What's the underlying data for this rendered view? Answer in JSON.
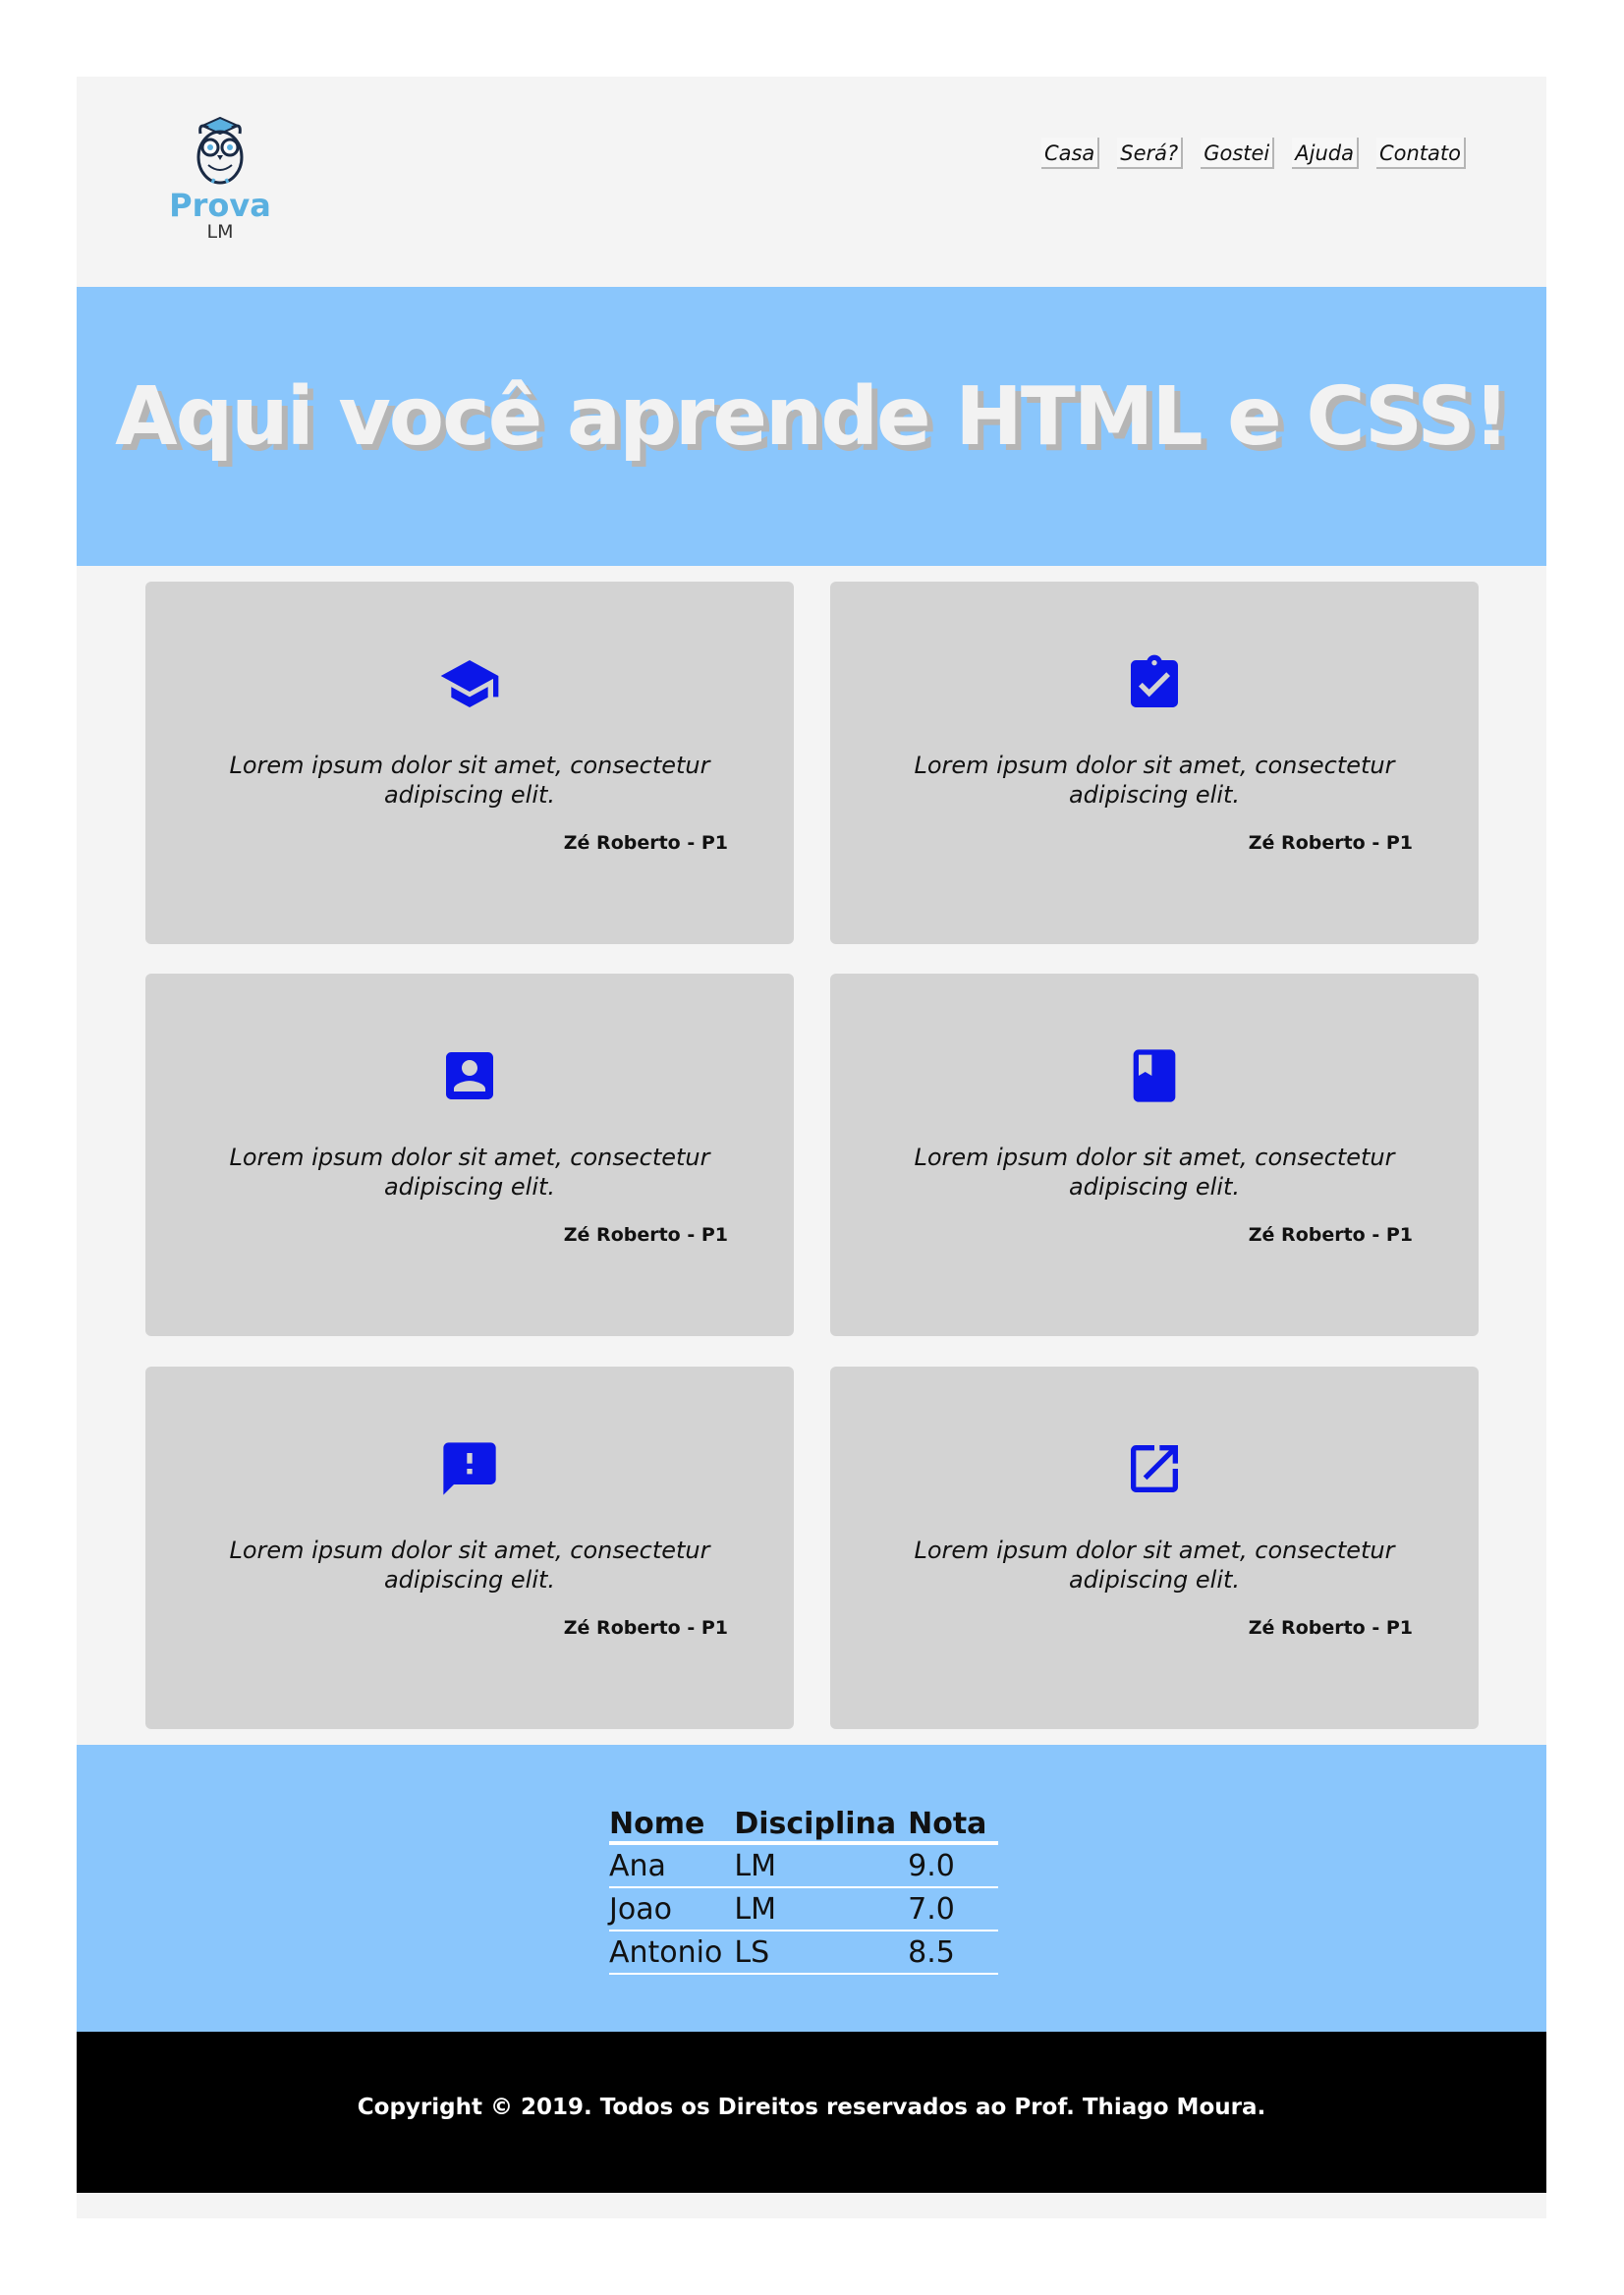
{
  "logo": {
    "title": "Prova",
    "subtitle": "LM"
  },
  "nav": {
    "items": [
      "Casa",
      "Será?",
      "Gostei",
      "Ajuda",
      "Contato"
    ]
  },
  "hero": {
    "title": "Aqui você aprende HTML e CSS!"
  },
  "cards": [
    {
      "icon": "graduation-cap-icon",
      "text": "Lorem ipsum dolor sit amet, consectetur adipiscing elit.",
      "author": "Zé Roberto - P1"
    },
    {
      "icon": "clipboard-check-icon",
      "text": "Lorem ipsum dolor sit amet, consectetur adipiscing elit.",
      "author": "Zé Roberto - P1"
    },
    {
      "icon": "contact-card-icon",
      "text": "Lorem ipsum dolor sit amet, consectetur adipiscing elit.",
      "author": "Zé Roberto - P1"
    },
    {
      "icon": "book-icon",
      "text": "Lorem ipsum dolor sit amet, consectetur adipiscing elit.",
      "author": "Zé Roberto - P1"
    },
    {
      "icon": "feedback-icon",
      "text": "Lorem ipsum dolor sit amet, consectetur adipiscing elit.",
      "author": "Zé Roberto - P1"
    },
    {
      "icon": "open-in-new-icon",
      "text": "Lorem ipsum dolor sit amet, consectetur adipiscing elit.",
      "author": "Zé Roberto - P1"
    }
  ],
  "table": {
    "headers": [
      "Nome",
      "Disciplina",
      "Nota"
    ],
    "rows": [
      [
        "Ana",
        "LM",
        "9.0"
      ],
      [
        "Joao",
        "LM",
        "7.0"
      ],
      [
        "Antonio",
        "LS",
        "8.5"
      ]
    ]
  },
  "footer": {
    "text": "Copyright © 2019. Todos os Direitos reservados ao Prof. Thiago Moura."
  },
  "colors": {
    "accent": "#8ac6fc",
    "icon": "#0b16e8",
    "card": "#d3d3d3",
    "footer": "#000000",
    "logo": "#5ab0e0"
  }
}
